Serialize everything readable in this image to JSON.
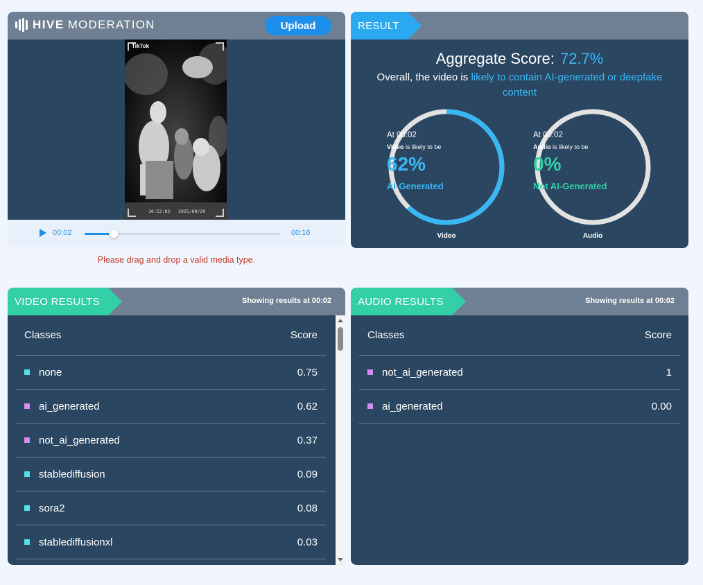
{
  "brand": {
    "bold": "HIVE",
    "thin": "MODERATION"
  },
  "upload": {
    "button_label": "Upload",
    "error": "Please drag and drop a valid media type."
  },
  "player": {
    "current_time": "00:02",
    "duration": "00:16",
    "progress": 0.15
  },
  "video_overlay": {
    "top_text": "TikTok",
    "timestamp": "10:52:03   2025/08/20"
  },
  "result": {
    "tag": "RESULT",
    "aggregate_label": "Aggregate Score:",
    "aggregate_value": "72.7%",
    "overall_prefix": "Overall, the video is ",
    "overall_highlight": "likely to contain AI-generated or deepfake content",
    "video_ring": {
      "at": "At 00:02",
      "subject": "Video",
      "likely": " is likely to be",
      "pct": "62%",
      "fraction": 0.62,
      "label": "AI-Generated",
      "caption": "Video",
      "color": "#39b7f4"
    },
    "audio_ring": {
      "at": "At 00:02",
      "subject": "Audio",
      "likely": " is likely to be",
      "pct": "0%",
      "fraction": 0,
      "label": "Not AI-Generated",
      "caption": "Audio",
      "color": "#33cfa6"
    }
  },
  "video_results": {
    "tag": "VIDEO RESULTS",
    "showing_prefix": "Showing results at ",
    "showing_time": "00:02",
    "col_classes": "Classes",
    "col_score": "Score",
    "rows": [
      {
        "name": "none",
        "score": "0.75",
        "color": "#53e1e6"
      },
      {
        "name": "ai_generated",
        "score": "0.62",
        "color": "#d58cf0"
      },
      {
        "name": "not_ai_generated",
        "score": "0.37",
        "color": "#d58cf0"
      },
      {
        "name": "stablediffusion",
        "score": "0.09",
        "color": "#53e1e6"
      },
      {
        "name": "sora2",
        "score": "0.08",
        "color": "#53e1e6"
      },
      {
        "name": "stablediffusionxl",
        "score": "0.03",
        "color": "#53e1e6"
      }
    ]
  },
  "audio_results": {
    "tag": "AUDIO RESULTS",
    "showing_prefix": "Showing results at ",
    "showing_time": "00:02",
    "col_classes": "Classes",
    "col_score": "Score",
    "rows": [
      {
        "name": "not_ai_generated",
        "score": "1",
        "color": "#d58cf0"
      },
      {
        "name": "ai_generated",
        "score": "0.00",
        "color": "#d58cf0"
      }
    ]
  }
}
